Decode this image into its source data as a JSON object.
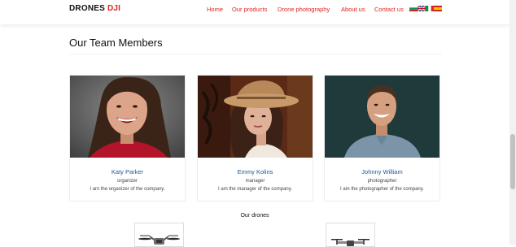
{
  "header": {
    "logo_part1": "DRONES",
    "logo_part2": "DJI",
    "nav": [
      "Home",
      "Our products",
      "Drone photography",
      "About us",
      "Contact us"
    ],
    "languages": [
      "bulgarian-flag-icon",
      "uk-flag-icon",
      "italian-flag-icon",
      "spanish-flag-icon"
    ]
  },
  "team": {
    "title": "Our Team Members",
    "members": [
      {
        "name": "Katy Parker",
        "role": "organizer",
        "description": "I am the organizer of the company."
      },
      {
        "name": "Emmy Kolins",
        "role": "manager",
        "description": "I am the manager of the company."
      },
      {
        "name": "Johnny William",
        "role": "photographer",
        "description": "I am the photographer of the company."
      }
    ]
  },
  "drones": {
    "title": "Our drones"
  },
  "colors": {
    "accent": "#e2231a",
    "name": "#1a5a99"
  }
}
